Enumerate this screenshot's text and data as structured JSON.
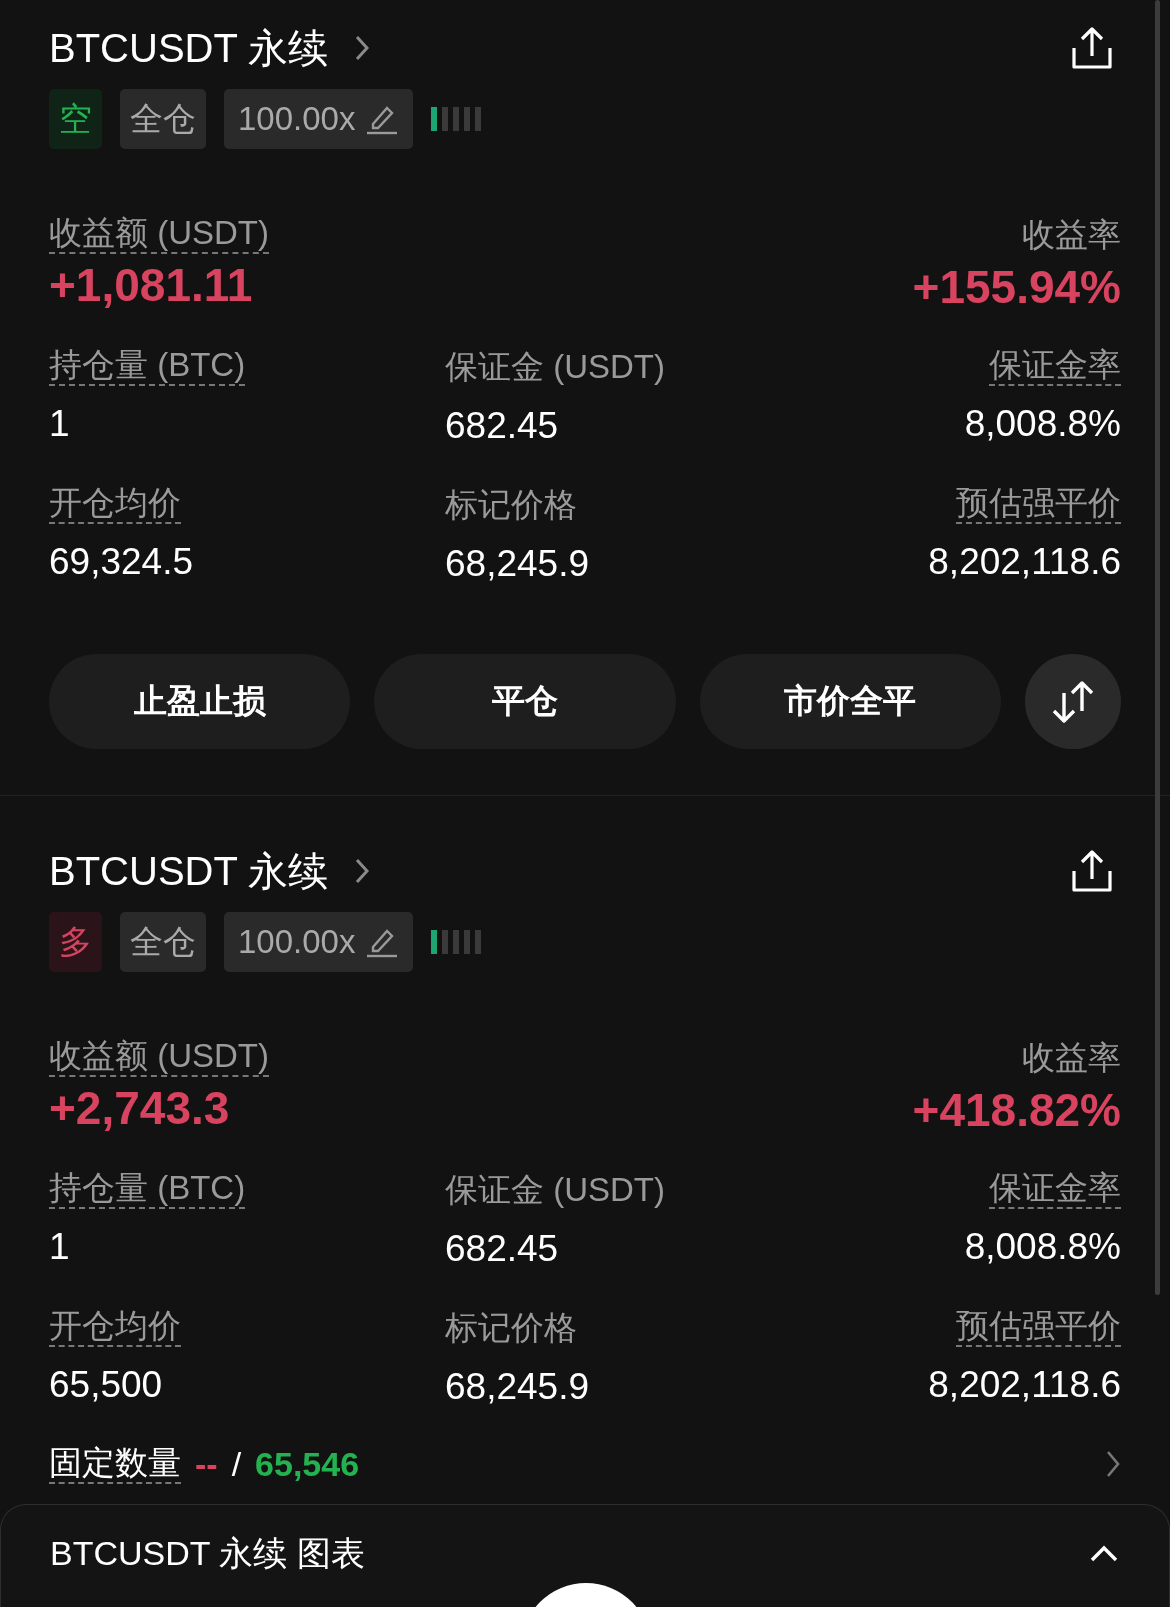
{
  "positions": [
    {
      "symbol": "BTCUSDT 永续",
      "side": {
        "kind": "short",
        "label": "空"
      },
      "margin_mode": "全仓",
      "leverage": "100.00x",
      "risk": {
        "level": 0.2
      },
      "pnl": {
        "label": "收益额 (USDT)",
        "value": "+1,081.11"
      },
      "roe": {
        "label": "收益率",
        "value": "+155.94%"
      },
      "stats": [
        {
          "label": "持仓量 (BTC)",
          "value": "1",
          "dashed": true
        },
        {
          "label": "保证金 (USDT)",
          "value": "682.45",
          "dashed": false
        },
        {
          "label": "保证金率",
          "value": "8,008.8%",
          "dashed": true
        },
        {
          "label": "开仓均价",
          "value": "69,324.5",
          "dashed": true
        },
        {
          "label": "标记价格",
          "value": "68,245.9",
          "dashed": false
        },
        {
          "label": "预估强平价",
          "value": "8,202,118.6",
          "dashed": true
        }
      ],
      "buttons": [
        "止盈止损",
        "平仓",
        "市价全平"
      ]
    },
    {
      "symbol": "BTCUSDT 永续",
      "side": {
        "kind": "long",
        "label": "多"
      },
      "margin_mode": "全仓",
      "leverage": "100.00x",
      "risk": {
        "level": 0.2
      },
      "pnl": {
        "label": "收益额 (USDT)",
        "value": "+2,743.3"
      },
      "roe": {
        "label": "收益率",
        "value": "+418.82%"
      },
      "stats": [
        {
          "label": "持仓量 (BTC)",
          "value": "1",
          "dashed": true
        },
        {
          "label": "保证金 (USDT)",
          "value": "682.45",
          "dashed": false
        },
        {
          "label": "保证金率",
          "value": "8,008.8%",
          "dashed": true
        },
        {
          "label": "开仓均价",
          "value": "65,500",
          "dashed": true
        },
        {
          "label": "标记价格",
          "value": "68,245.9",
          "dashed": false
        },
        {
          "label": "预估强平价",
          "value": "8,202,118.6",
          "dashed": true
        }
      ],
      "fixed_quantity": {
        "label": "固定数量",
        "take_profit": "--",
        "separator": "/",
        "stop_loss": "65,546"
      }
    }
  ],
  "chart_panel": {
    "title": "BTCUSDT 永续 图表",
    "expanded": false
  }
}
